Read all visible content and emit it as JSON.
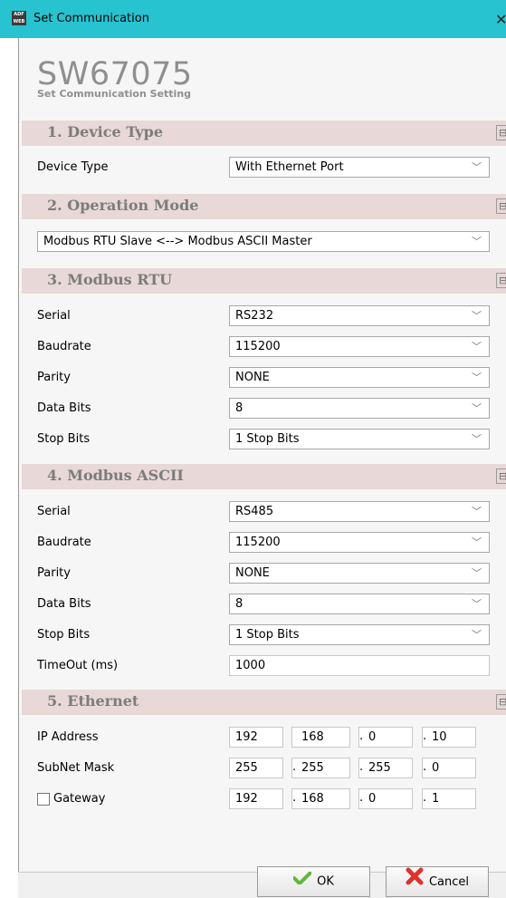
{
  "window": {
    "title": "Set Communication",
    "app_icon_text": "ADF WEB",
    "close_glyph": "✕"
  },
  "brand": {
    "product": "SW67075",
    "subtitle": "Set Communication Setting"
  },
  "section1": {
    "title": "1. Device Type",
    "collapse": "⊟",
    "device_type_label": "Device Type",
    "device_type_value": "With Ethernet Port"
  },
  "section2": {
    "title": "2. Operation Mode",
    "collapse": "⊟",
    "mode_value": "Modbus RTU Slave <--> Modbus ASCII Master"
  },
  "section3": {
    "title": "3. Modbus RTU",
    "collapse": "⊟",
    "serial_label": "Serial",
    "serial_value": "RS232",
    "baudrate_label": "Baudrate",
    "baudrate_value": "115200",
    "parity_label": "Parity",
    "parity_value": "NONE",
    "databits_label": "Data Bits",
    "databits_value": "8",
    "stopbits_label": "Stop Bits",
    "stopbits_value": "1 Stop Bits"
  },
  "section4": {
    "title": "4. Modbus ASCII",
    "collapse": "⊟",
    "serial_label": "Serial",
    "serial_value": "RS485",
    "baudrate_label": "Baudrate",
    "baudrate_value": "115200",
    "parity_label": "Parity",
    "parity_value": "NONE",
    "databits_label": "Data Bits",
    "databits_value": "8",
    "stopbits_label": "Stop Bits",
    "stopbits_value": "1 Stop Bits",
    "timeout_label": "TimeOut (ms)",
    "timeout_value": "1000"
  },
  "section5": {
    "title": "5. Ethernet",
    "collapse": "⊟",
    "ip_label": "IP Address",
    "ip": [
      "192",
      "168",
      "0",
      "10"
    ],
    "subnet_label": "SubNet Mask",
    "subnet": [
      "255",
      "255",
      "255",
      "0"
    ],
    "gateway_label": "Gateway",
    "gateway_checked": false,
    "gateway": [
      "192",
      "168",
      "0",
      "1"
    ]
  },
  "footer": {
    "ok_label": "OK",
    "cancel_label": "Cancel"
  },
  "colors": {
    "titlebar": "#27c3d1",
    "section_bg": "#e8d8d8",
    "section_text": "#7c7c7c",
    "brand": "#8f8f8f",
    "ok_icon": "#5fb83a",
    "cancel_icon": "#e0312a"
  }
}
